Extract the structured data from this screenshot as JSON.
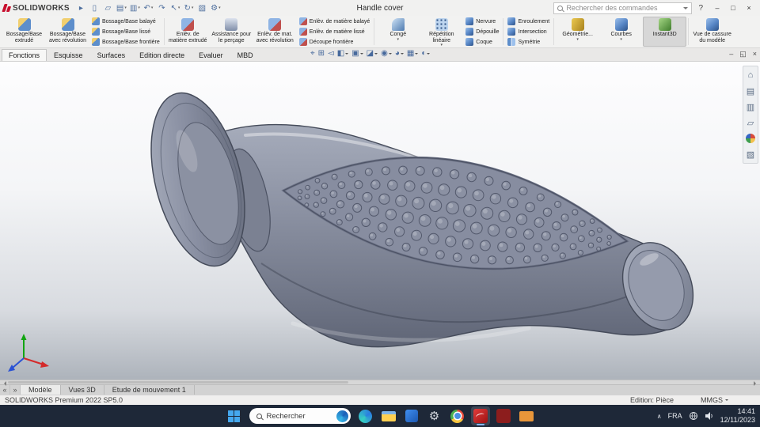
{
  "titlebar": {
    "logo_text": "SOLIDWORKS",
    "doc_title": "Handle cover",
    "search_placeholder": "Rechercher des commandes",
    "help_label": "?",
    "quick_icons": [
      {
        "name": "menu-expand",
        "glyph": "▸"
      },
      {
        "name": "new-document",
        "glyph": "▯"
      },
      {
        "name": "open-document",
        "glyph": "▱"
      },
      {
        "name": "save",
        "glyph": "▤",
        "caret": true
      },
      {
        "name": "print",
        "glyph": "▥",
        "caret": true
      },
      {
        "name": "undo",
        "glyph": "↶",
        "caret": true
      },
      {
        "name": "redo",
        "glyph": "↷"
      },
      {
        "name": "select",
        "glyph": "↖",
        "caret": true
      },
      {
        "name": "rebuild",
        "glyph": "↻",
        "caret": true
      },
      {
        "name": "file-properties",
        "glyph": "▧"
      },
      {
        "name": "options",
        "glyph": "⚙",
        "caret": true
      }
    ],
    "window_controls": [
      {
        "name": "minimize",
        "glyph": "–"
      },
      {
        "name": "maximize",
        "glyph": "□"
      },
      {
        "name": "close",
        "glyph": "×"
      }
    ]
  },
  "ribbon": {
    "groups": [
      {
        "items": [
          {
            "label": "Bossage/Base extrudé",
            "size": "large",
            "icon": "extrude-boss"
          },
          {
            "label": "Bossage/Base avec révolution",
            "size": "large",
            "icon": "revolve-boss"
          },
          {
            "label": "Bossage/Base balayé",
            "size": "small",
            "icon": "sweep-boss"
          },
          {
            "label": "Bossage/Base lissé",
            "size": "small",
            "icon": "loft-boss"
          },
          {
            "label": "Bossage/Base frontière",
            "size": "small",
            "icon": "boundary-boss"
          }
        ]
      },
      {
        "items": [
          {
            "label": "Enlèv. de matière extrudé",
            "size": "large",
            "icon": "extrude-cut"
          },
          {
            "label": "Assistance pour le perçage",
            "size": "large",
            "icon": "hole-wizard"
          },
          {
            "label": "Enlèv. de mat. avec révolution",
            "size": "large",
            "icon": "revolve-cut"
          },
          {
            "label": "Enlèv. de matière balayé",
            "size": "small",
            "icon": "sweep-cut"
          },
          {
            "label": "Enlèv. de matière lissé",
            "size": "small",
            "icon": "loft-cut"
          },
          {
            "label": "Découpe frontière",
            "size": "small",
            "icon": "boundary-cut"
          }
        ]
      },
      {
        "items": [
          {
            "label": "Congé",
            "size": "large",
            "icon": "fillet",
            "caret": true
          },
          {
            "label": "Répétition linéaire",
            "size": "large",
            "icon": "linear-pattern",
            "caret": true
          },
          {
            "label": "Nervure",
            "size": "small",
            "icon": "rib"
          },
          {
            "label": "Dépouille",
            "size": "small",
            "icon": "draft"
          },
          {
            "label": "Coque",
            "size": "small",
            "icon": "shell"
          }
        ]
      },
      {
        "items": [
          {
            "label": "Enroulement",
            "size": "small",
            "icon": "wrap"
          },
          {
            "label": "Intersection",
            "size": "small",
            "icon": "intersect"
          },
          {
            "label": "Symétrie",
            "size": "small",
            "icon": "mirror"
          }
        ]
      },
      {
        "items": [
          {
            "label": "Géométrie...",
            "size": "large",
            "icon": "reference-geometry",
            "caret": true
          },
          {
            "label": "Courbes",
            "size": "large",
            "icon": "curves",
            "caret": true
          },
          {
            "label": "Instant3D",
            "size": "large",
            "icon": "instant3d",
            "selected": true
          }
        ]
      },
      {
        "items": [
          {
            "label": "Vue de cassure du modèle",
            "size": "large",
            "icon": "model-break-view"
          }
        ]
      }
    ]
  },
  "command_tabs": [
    {
      "label": "Fonctions",
      "active": true
    },
    {
      "label": "Esquisse"
    },
    {
      "label": "Surfaces"
    },
    {
      "label": "Edition directe"
    },
    {
      "label": "Evaluer"
    },
    {
      "label": "MBD"
    }
  ],
  "headsup_icons": [
    {
      "name": "zoom-fit",
      "glyph": "⌖"
    },
    {
      "name": "zoom-area",
      "glyph": "⊞"
    },
    {
      "name": "previous-view",
      "glyph": "◅"
    },
    {
      "name": "section-view",
      "glyph": "◧",
      "caret": true
    },
    {
      "name": "view-orientation",
      "glyph": "▣",
      "caret": true
    },
    {
      "name": "display-style",
      "glyph": "◪",
      "caret": true
    },
    {
      "name": "hide-show-items",
      "glyph": "◉",
      "caret": true
    },
    {
      "name": "edit-appearance",
      "glyph": "◕",
      "caret": true
    },
    {
      "name": "apply-scene",
      "glyph": "▦",
      "caret": true
    },
    {
      "name": "view-settings",
      "glyph": "◐",
      "caret": true
    }
  ],
  "doc_controls": [
    {
      "name": "minimize-document",
      "glyph": "–"
    },
    {
      "name": "restore-document",
      "glyph": "◱"
    },
    {
      "name": "close-document",
      "glyph": "×"
    }
  ],
  "taskpane": {
    "icons": [
      {
        "name": "home",
        "glyph": "⌂"
      },
      {
        "name": "solidworks-resources",
        "glyph": "▤"
      },
      {
        "name": "design-library",
        "glyph": "▥"
      },
      {
        "name": "file-explorer-pane",
        "glyph": "▱"
      },
      {
        "name": "appearances-scenes",
        "colored": true
      },
      {
        "name": "custom-properties",
        "glyph": "▧"
      }
    ]
  },
  "model_tabs": {
    "nav": [
      {
        "name": "scroll-tabs-left",
        "glyph": "«"
      },
      {
        "name": "scroll-tabs-right",
        "glyph": "»"
      }
    ],
    "tabs": [
      {
        "label": "Modèle",
        "active": true
      },
      {
        "label": "Vues 3D"
      },
      {
        "label": "Etude de mouvement 1"
      }
    ]
  },
  "statusbar": {
    "left": "SOLIDWORKS Premium 2022 SP5.0",
    "items": [
      {
        "label": "Edition: Pièce"
      },
      {
        "label": "MMGS",
        "caret": true
      }
    ]
  },
  "taskbar": {
    "search_placeholder": "Rechercher",
    "apps": [
      {
        "name": "edge"
      },
      {
        "name": "file-explorer"
      },
      {
        "name": "outlook"
      },
      {
        "name": "settings",
        "glyph": "⚙"
      },
      {
        "name": "chrome"
      },
      {
        "name": "solidworks",
        "active": true
      },
      {
        "name": "solidworks-rx"
      },
      {
        "name": "documents"
      }
    ],
    "tray": {
      "chevron": "∧",
      "lang": "FRA",
      "time": "14:41",
      "date": "12/11/2023"
    }
  },
  "colors": {
    "model_body": "#868c9d",
    "taskbar_bg": "#1e2838",
    "logo_red": "#c8102e",
    "accent_blue": "#2f6fd0"
  }
}
